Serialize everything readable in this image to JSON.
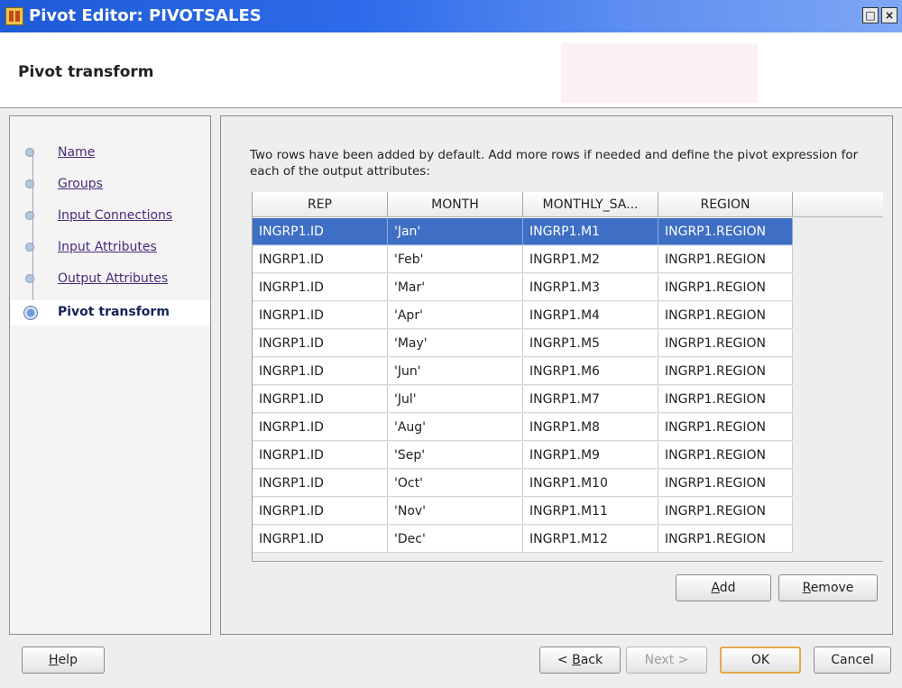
{
  "window": {
    "title": "Pivot Editor: PIVOTSALES",
    "restore_glyph": "□",
    "close_glyph": "×"
  },
  "header": {
    "title": "Pivot transform"
  },
  "nav": {
    "items": [
      {
        "label": "Name",
        "state": "visited"
      },
      {
        "label": "Groups",
        "state": "visited"
      },
      {
        "label": "Input Connections",
        "state": "visited"
      },
      {
        "label": "Input Attributes",
        "state": "visited"
      },
      {
        "label": "Output Attributes",
        "state": "visited"
      },
      {
        "label": "Pivot transform",
        "state": "current"
      }
    ]
  },
  "main": {
    "instructions": "Two rows have been added by default. Add more rows if needed and define the pivot expression for each of the output attributes:",
    "table": {
      "columns": [
        "REP",
        "MONTH",
        "MONTHLY_SA...",
        "REGION"
      ],
      "selected_row": 0,
      "rows": [
        [
          "INGRP1.ID",
          "'Jan'",
          "INGRP1.M1",
          "INGRP1.REGION"
        ],
        [
          "INGRP1.ID",
          "'Feb'",
          "INGRP1.M2",
          "INGRP1.REGION"
        ],
        [
          "INGRP1.ID",
          "'Mar'",
          "INGRP1.M3",
          "INGRP1.REGION"
        ],
        [
          "INGRP1.ID",
          "'Apr'",
          "INGRP1.M4",
          "INGRP1.REGION"
        ],
        [
          "INGRP1.ID",
          "'May'",
          "INGRP1.M5",
          "INGRP1.REGION"
        ],
        [
          "INGRP1.ID",
          "'Jun'",
          "INGRP1.M6",
          "INGRP1.REGION"
        ],
        [
          "INGRP1.ID",
          "'Jul'",
          "INGRP1.M7",
          "INGRP1.REGION"
        ],
        [
          "INGRP1.ID",
          "'Aug'",
          "INGRP1.M8",
          "INGRP1.REGION"
        ],
        [
          "INGRP1.ID",
          "'Sep'",
          "INGRP1.M9",
          "INGRP1.REGION"
        ],
        [
          "INGRP1.ID",
          "'Oct'",
          "INGRP1.M10",
          "INGRP1.REGION"
        ],
        [
          "INGRP1.ID",
          "'Nov'",
          "INGRP1.M11",
          "INGRP1.REGION"
        ],
        [
          "INGRP1.ID",
          "'Dec'",
          "INGRP1.M12",
          "INGRP1.REGION"
        ]
      ]
    },
    "add_button": {
      "mnemonic": "A",
      "rest": "dd"
    },
    "remove_button": {
      "mnemonic": "R",
      "rest": "emove"
    }
  },
  "footer": {
    "help_button": {
      "mnemonic": "H",
      "rest": "elp"
    },
    "back_button": {
      "prefix": "< ",
      "mnemonic": "B",
      "rest": "ack"
    },
    "next_button": {
      "label": "Next >"
    },
    "ok_button": {
      "label": "OK"
    },
    "cancel_button": {
      "label": "Cancel"
    }
  },
  "colors": {
    "titlebar": "#2d6bea",
    "selection": "#3e6fc4",
    "default_button_border": "#e6a84a"
  }
}
